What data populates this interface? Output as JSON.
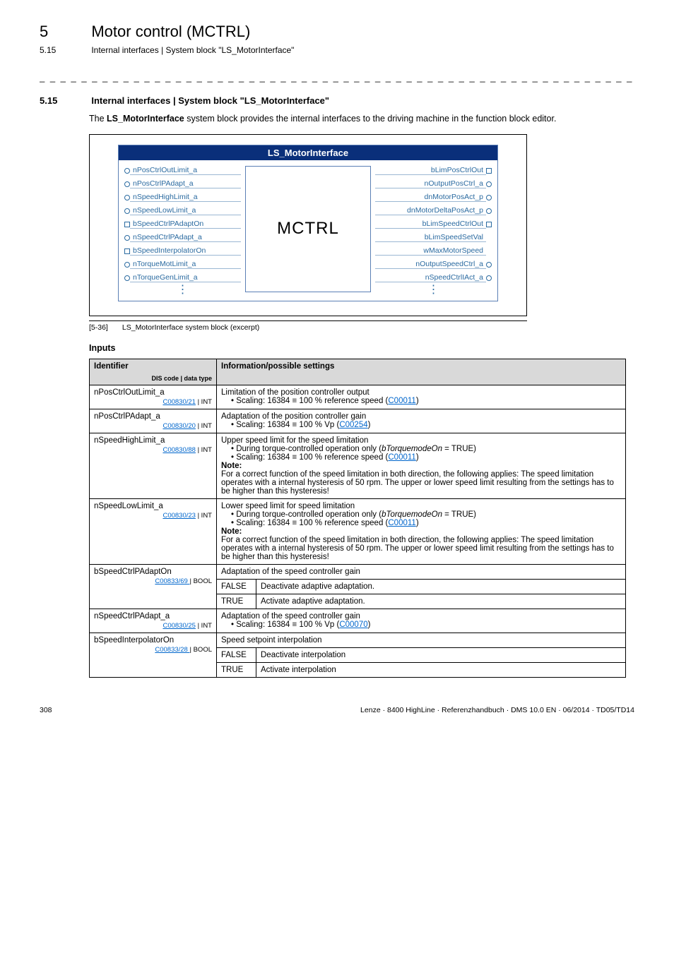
{
  "chapter": {
    "num": "5",
    "title": "Motor control (MCTRL)"
  },
  "subhead": {
    "num": "5.15",
    "title": "Internal interfaces | System block \"LS_MotorInterface\""
  },
  "section": {
    "num": "5.15",
    "title": "Internal interfaces | System block \"LS_MotorInterface\""
  },
  "intro": {
    "prefix": "The ",
    "bold": "LS_MotorInterface",
    "rest": " system block provides the internal interfaces to the driving machine in the function block editor."
  },
  "diagram": {
    "header": "LS_MotorInterface",
    "center": "MCTRL",
    "left_ports": [
      {
        "shape": "circle",
        "label": "nPosCtrlOutLimit_a"
      },
      {
        "shape": "circle",
        "label": "nPosCtrlPAdapt_a"
      },
      {
        "shape": "circle",
        "label": "nSpeedHighLimit_a"
      },
      {
        "shape": "circle",
        "label": "nSpeedLowLimit_a"
      },
      {
        "shape": "square",
        "label": "bSpeedCtrlPAdaptOn"
      },
      {
        "shape": "circle",
        "label": "nSpeedCtrlPAdapt_a"
      },
      {
        "shape": "square",
        "label": "bSpeedInterpolatorOn"
      },
      {
        "shape": "circle",
        "label": "nTorqueMotLimit_a"
      },
      {
        "shape": "circle",
        "label": "nTorqueGenLimit_a"
      }
    ],
    "right_ports": [
      {
        "shape": "square",
        "label": "bLimPosCtrlOut"
      },
      {
        "shape": "circle",
        "label": "nOutputPosCtrl_a"
      },
      {
        "shape": "circle",
        "label": "dnMotorPosAct_p"
      },
      {
        "shape": "circle",
        "label": "dnMotorDeltaPosAct_p"
      },
      {
        "shape": "square",
        "label": "bLimSpeedCtrlOut"
      },
      {
        "shape": "none",
        "label": "bLimSpeedSetVal"
      },
      {
        "shape": "none",
        "label": "wMaxMotorSpeed"
      },
      {
        "shape": "circle",
        "label": "nOutputSpeedCtrl_a"
      },
      {
        "shape": "circle",
        "label": "nSpeedCtrlIAct_a"
      }
    ]
  },
  "caption": {
    "tag": "[5-36]",
    "text": "LS_MotorInterface system block (excerpt)"
  },
  "inputs_heading": "Inputs",
  "table": {
    "head_identifier": "Identifier",
    "head_dis": "DIS code | data type",
    "head_info": "Information/possible settings",
    "rows": [
      {
        "ident": "nPosCtrlOutLimit_a",
        "code": "C00830/21",
        "dtype": "INT",
        "info_title": "Limitation of the position controller output",
        "bullets": [
          {
            "pre": "Scaling: 16384 ≡ 100 % reference speed (",
            "link": "C00011",
            "post": ")"
          }
        ]
      },
      {
        "ident": "nPosCtrlPAdapt_a",
        "code": "C00830/20",
        "dtype": "INT",
        "info_title": "Adaptation of the position controller gain",
        "bullets": [
          {
            "pre": "Scaling: 16384 ≡ 100 % Vp (",
            "link": "C00254",
            "post": ")"
          }
        ]
      },
      {
        "ident": "nSpeedHighLimit_a",
        "code": "C00830/88",
        "dtype": "INT",
        "info_title": "Upper speed limit for the speed limitation",
        "bullets": [
          {
            "pre": "During torque-controlled operation only (",
            "ital": "bTorquemodeOn",
            "post2": " = TRUE)"
          },
          {
            "pre": "Scaling: 16384 ≡ 100 % reference speed (",
            "link": "C00011",
            "post": ")"
          }
        ],
        "note_label": "Note:",
        "note_body": "For a correct function of the speed limitation in both direction, the following applies: The speed limitation operates with a internal hysteresis of 50 rpm. The upper or lower speed limit resulting from the settings has to be higher than this hysteresis!"
      },
      {
        "ident": "nSpeedLowLimit_a",
        "code": "C00830/23",
        "dtype": "INT",
        "info_title": "Lower speed limit for speed limitation",
        "bullets": [
          {
            "pre": "During torque-controlled operation only (",
            "ital": "bTorquemodeOn",
            "post2": " = TRUE)"
          },
          {
            "pre": "Scaling: 16384 ≡ 100 % reference speed (",
            "link": "C00011",
            "post": ")"
          }
        ],
        "note_label": "Note:",
        "note_body": "For a correct function of the speed limitation in both direction, the following applies: The speed limitation operates with a internal hysteresis of 50 rpm. The upper or lower speed limit resulting from the settings has to be higher than this hysteresis!"
      },
      {
        "ident": "bSpeedCtrlPAdaptOn",
        "code": "C00833/69 ",
        "dtype": "BOOL",
        "info_title": "Adaptation of the speed controller gain",
        "options": [
          {
            "key": "FALSE",
            "val": "Deactivate adaptive adaptation."
          },
          {
            "key": "TRUE",
            "val": "Activate adaptive adaptation."
          }
        ]
      },
      {
        "ident": "nSpeedCtrlPAdapt_a",
        "code": "C00830/25",
        "dtype": "INT",
        "info_title": "Adaptation of the speed controller gain",
        "bullets": [
          {
            "pre": "Scaling: 16384 ≡ 100 % Vp (",
            "link": "C00070",
            "post": ")"
          }
        ]
      },
      {
        "ident": "bSpeedInterpolatorOn",
        "code": "C00833/28 ",
        "dtype": "BOOL",
        "info_title": "Speed setpoint interpolation",
        "options": [
          {
            "key": "FALSE",
            "val": "Deactivate interpolation"
          },
          {
            "key": "TRUE",
            "val": "Activate interpolation"
          }
        ]
      }
    ]
  },
  "footer": {
    "page": "308",
    "right": "Lenze · 8400 HighLine · Referenzhandbuch · DMS 10.0 EN · 06/2014 · TD05/TD14"
  }
}
